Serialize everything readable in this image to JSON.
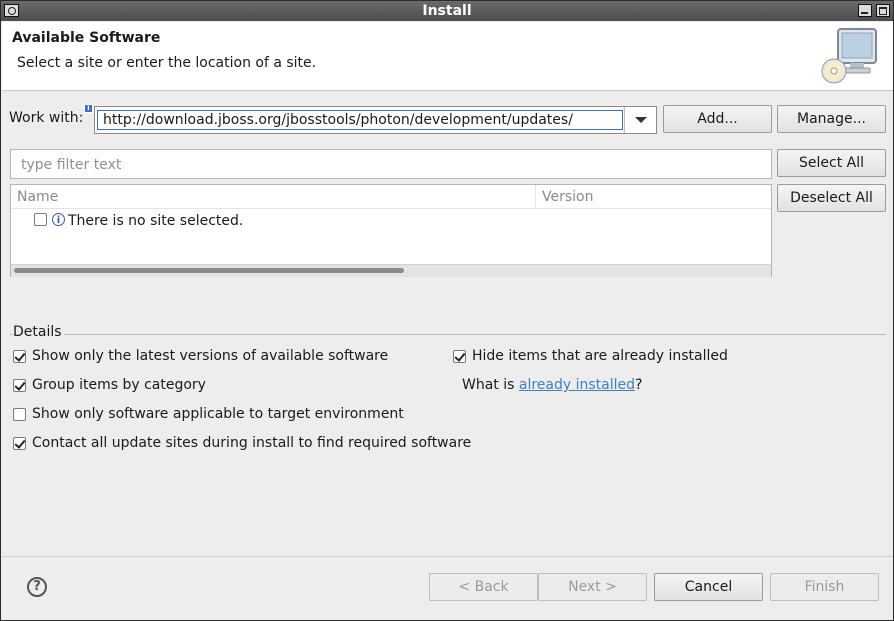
{
  "window": {
    "title": "Install"
  },
  "header": {
    "title": "Available Software",
    "description": "Select a site or enter the location of a site.",
    "icon": "install-computer-cd-icon"
  },
  "work_with": {
    "label": "Work with:",
    "value": "http://download.jboss.org/jbosstools/photon/development/updates/",
    "add_label": "Add...",
    "manage_label": "Manage..."
  },
  "filter": {
    "placeholder": "type filter text",
    "select_all_label": "Select All",
    "deselect_all_label": "Deselect All"
  },
  "table": {
    "columns": [
      "Name",
      "Version"
    ],
    "rows": [
      {
        "name": "There is no site selected.",
        "checked": false
      }
    ]
  },
  "details": {
    "title": "Details",
    "options": [
      {
        "label": "Show only the latest versions of available software",
        "checked": true
      },
      {
        "label": "Group items by category",
        "checked": true
      },
      {
        "label": "Show only software applicable to target environment",
        "checked": false
      },
      {
        "label": "Contact all update sites during install to find required software",
        "checked": true
      },
      {
        "label": "Hide items that are already installed",
        "checked": true
      }
    ],
    "what_is_prefix": "What is ",
    "what_is_link": "already installed",
    "what_is_suffix": "?"
  },
  "footer": {
    "back_label": "< Back",
    "next_label": "Next >",
    "cancel_label": "Cancel",
    "finish_label": "Finish"
  }
}
